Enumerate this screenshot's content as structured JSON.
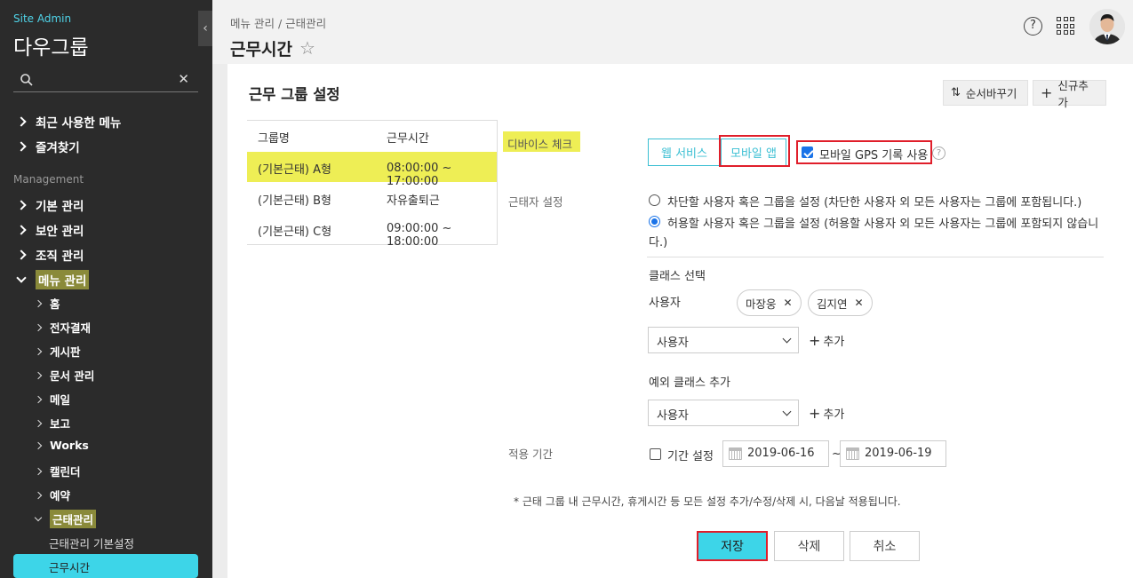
{
  "sidebar": {
    "site_admin": "Site Admin",
    "company": "다우그룹",
    "recent_menu": "최근 사용한 메뉴",
    "favorites": "즐겨찾기",
    "section_label": "Management",
    "items": [
      {
        "label": "기본 관리"
      },
      {
        "label": "보안 관리"
      },
      {
        "label": "조직 관리"
      },
      {
        "label": "메뉴 관리"
      }
    ],
    "sub_items": [
      {
        "label": "홈"
      },
      {
        "label": "전자결재"
      },
      {
        "label": "게시판"
      },
      {
        "label": "문서 관리"
      },
      {
        "label": "메일"
      },
      {
        "label": "보고"
      },
      {
        "label": "Works"
      },
      {
        "label": "캘린더"
      },
      {
        "label": "예약"
      },
      {
        "label": "근태관리"
      }
    ],
    "leaves": [
      {
        "label": "근태관리 기본설정"
      },
      {
        "label": "근무시간"
      }
    ]
  },
  "header": {
    "breadcrumb": "메뉴 관리 / 근태관리",
    "title": "근무시간",
    "help_icon": "?"
  },
  "panel": {
    "title": "근무 그룹 설정",
    "reorder_label": "순서바꾸기",
    "add_label": "신규추가",
    "table": {
      "headers": [
        "그룹명",
        "근무시간"
      ],
      "rows": [
        {
          "name": "(기본근태) A형",
          "time": "08:00:00 ~ 17:00:00"
        },
        {
          "name": "(기본근태) B형",
          "time": "자유출퇴근"
        },
        {
          "name": "(기본근태) C형",
          "time": "09:00:00 ~ 18:00:00"
        }
      ]
    },
    "device_check_label": "디바이스 체크",
    "web_service": "웹 서비스",
    "mobile_app": "모바일 앱",
    "gps_label": "모바일 GPS 기록 사용",
    "worker_setting_label": "근태자 설정",
    "radio_block": "차단할 사용자 혹은 그룹을 설정 (차단한 사용자 외 모든 사용자는 그룹에 포함됩니다.)",
    "radio_allow_1": "허용할 사용자 혹은 그룹을 설정 (허용할 사용자 외 모든 사용자는 그룹에 포함되지 않습니",
    "radio_allow_2": "다.)",
    "class_select_label": "클래스 선택",
    "user_label": "사용자",
    "chips": [
      "마장웅",
      "김지연"
    ],
    "select_value": "사용자",
    "add_text": "추가",
    "exception_label": "예외 클래스 추가",
    "select_value_2": "사용자",
    "period_label": "적용 기간",
    "period_checkbox_label": "기간 설정",
    "date_from": "2019-06-16",
    "date_to": "2019-06-19",
    "tilde": "~",
    "note": "* 근태 그룹 내 근무시간, 휴게시간 등 모든 설정 추가/수정/삭제 시, 다음날 적용됩니다.",
    "save": "저장",
    "delete": "삭제",
    "cancel": "취소"
  }
}
